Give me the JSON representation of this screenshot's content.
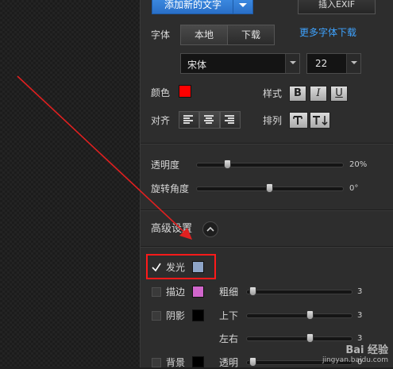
{
  "toolbar": {
    "add_text_label": "添加新的文字",
    "insert_exif_label": "插入EXIF"
  },
  "font": {
    "label": "字体",
    "source_tabs": [
      "本地",
      "下载"
    ],
    "more_fonts_link": "更多字体下载",
    "family": "宋体",
    "size": "22"
  },
  "color": {
    "label": "颜色",
    "value": "#ff0000"
  },
  "style": {
    "label": "样式",
    "buttons": [
      "B",
      "I",
      "U"
    ]
  },
  "align": {
    "label": "对齐"
  },
  "arrange": {
    "label": "排列"
  },
  "opacity": {
    "label": "透明度",
    "value_text": "20%",
    "value": 0.2
  },
  "rotation": {
    "label": "旋转角度",
    "value_text": "0°",
    "value": 0.5
  },
  "advanced": {
    "label": "高级设置",
    "glow": {
      "label": "发光",
      "checked": true,
      "color": "#8ea5c8"
    },
    "stroke": {
      "label": "描边",
      "checked": false,
      "color": "#d066cc"
    },
    "shadow": {
      "label": "阴影",
      "checked": false,
      "color": "#000000"
    },
    "background": {
      "label": "背景",
      "checked": false,
      "color": "#000000"
    },
    "thickness": {
      "label": "粗细",
      "value_text": "3",
      "value": 0.03
    },
    "vertical": {
      "label": "上下",
      "value_text": "3",
      "value": 0.62
    },
    "horizontal": {
      "label": "左右",
      "value_text": "3",
      "value": 0.62
    },
    "transparency": {
      "label": "透明",
      "value_text": "0",
      "value": 0.03
    }
  },
  "watermark": {
    "line1": "Bai 经验",
    "line2": "jingyan.baidu.com"
  },
  "colors": {
    "accent": "#2a6fc7",
    "highlight_box": "#ff1a1a",
    "arrow": "#e02020"
  }
}
